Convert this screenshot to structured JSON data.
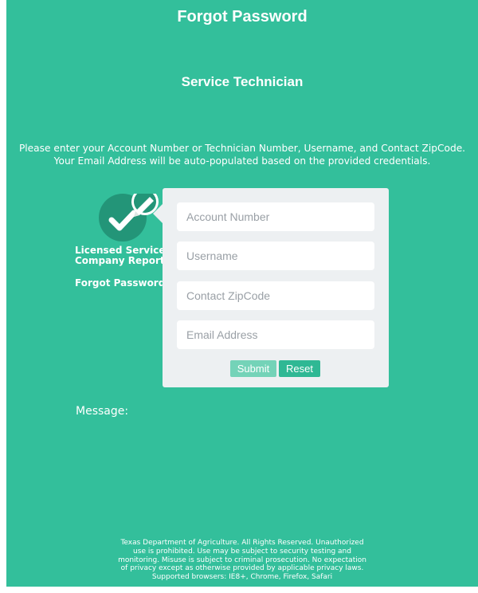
{
  "header": {
    "title": "Forgot Password",
    "subtitle": "Service Technician"
  },
  "instructions": {
    "line1": "Please enter your Account Number or Technician Number, Username, and Contact ZipCode.",
    "line2": "Your Email Address will be auto-populated based on the provided credentials."
  },
  "sidebar": {
    "icon": "check-edit-icon",
    "report_line1": "Licensed Service",
    "report_line2": "Company Report",
    "forgot_password": "Forgot Password"
  },
  "form": {
    "account_number": {
      "placeholder": "Account Number",
      "value": ""
    },
    "username": {
      "placeholder": "Username",
      "value": ""
    },
    "zipcode": {
      "placeholder": "Contact ZipCode",
      "value": ""
    },
    "email": {
      "placeholder": "Email Address",
      "value": ""
    },
    "submit_label": "Submit",
    "reset_label": "Reset"
  },
  "message": {
    "label": "Message:"
  },
  "footer": {
    "line1": "Texas Department of Agriculture. All Rights Reserved. Unauthorized",
    "line2": "use is prohibited. Use may be subject to security testing and",
    "line3": "monitoring. Misuse is subject to criminal prosecution. No expectation",
    "line4": "of privacy except as otherwise provided by applicable privacy laws.",
    "line5": "Supported browsers: IE8+, Chrome, Firefox, Safari"
  },
  "colors": {
    "background": "#33bf9b",
    "badge": "#239578",
    "card": "#edf0f2",
    "submit": "#74d3b8",
    "reset": "#2fb894"
  }
}
